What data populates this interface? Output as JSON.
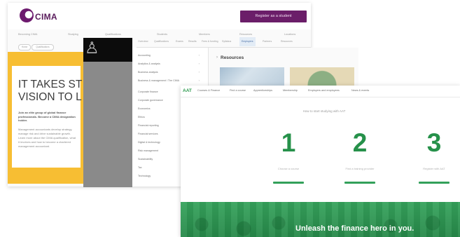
{
  "cima": {
    "logo_text": "CIMA",
    "cta_label": "Register as a student",
    "nav": [
      "Becoming CIMA",
      "Studying",
      "Qualifications",
      "Students",
      "Members",
      "Resources",
      "Locations"
    ],
    "crumbs": [
      "Home",
      "Qualifications"
    ],
    "tabs": [
      "Overview",
      "Qualifications",
      "Exams",
      "Results",
      "Fees & funding",
      "Syllabus",
      "Employers",
      "Partners",
      "Resources"
    ],
    "hero": {
      "title_line1": "IT TAKES ST",
      "title_line2": "VISION TO L",
      "lead": "Join an elite group of global finance professionals. Become a CIMA designation holder.",
      "body": "Management accountants develop strategy, manage risk and drive sustainable growth. Learn more about the CIMA qualification, what it involves and how to become a chartered management accountant."
    }
  },
  "dropdown": {
    "items": [
      "Accounting",
      "Analytics & analysis",
      "Business analysis",
      "Business & management / The CIMA",
      "Corporate finance",
      "Corporate governance",
      "Economics",
      "Ethics",
      "Financial reporting",
      "Financial services",
      "Digital & technology",
      "Risk management",
      "Sustainability",
      "Tax",
      "Technology"
    ]
  },
  "resources": {
    "title": "Resources"
  },
  "green": {
    "logo": "AAT",
    "nav": [
      "Courses & Finance",
      "Find a course",
      "Apprenticeships",
      "Membership",
      "Employers and employees",
      "News & events"
    ],
    "subtitle": "How to start studying with AAT",
    "steps": [
      {
        "num": "1",
        "label": "Choose a course"
      },
      {
        "num": "2",
        "label": "Find a training provider"
      },
      {
        "num": "3",
        "label": "Register with AAT"
      }
    ],
    "tagline": "Unleash the finance hero in you."
  }
}
